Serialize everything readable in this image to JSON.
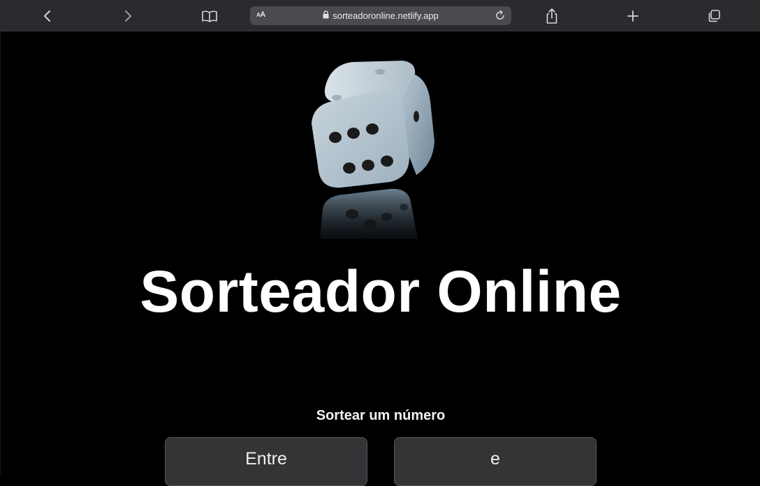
{
  "browser": {
    "reader_label": "AA",
    "url": "sorteadoronline.netlify.app",
    "icons": [
      "back-icon",
      "forward-icon",
      "bookmarks-icon",
      "lock-icon",
      "reload-icon",
      "share-icon",
      "new-tab-icon",
      "tabs-icon"
    ]
  },
  "page": {
    "title": "Sorteador Online",
    "subtitle": "Sortear um número",
    "fields": [
      {
        "placeholder": "Entre"
      },
      {
        "placeholder": "e"
      }
    ],
    "logo_icon": "dice-icon"
  },
  "colors": {
    "background": "#000000",
    "toolbar": "#2a2b2e",
    "address_bar": "#4a4b4f",
    "field_bg": "#333436",
    "text": "#ffffff"
  }
}
